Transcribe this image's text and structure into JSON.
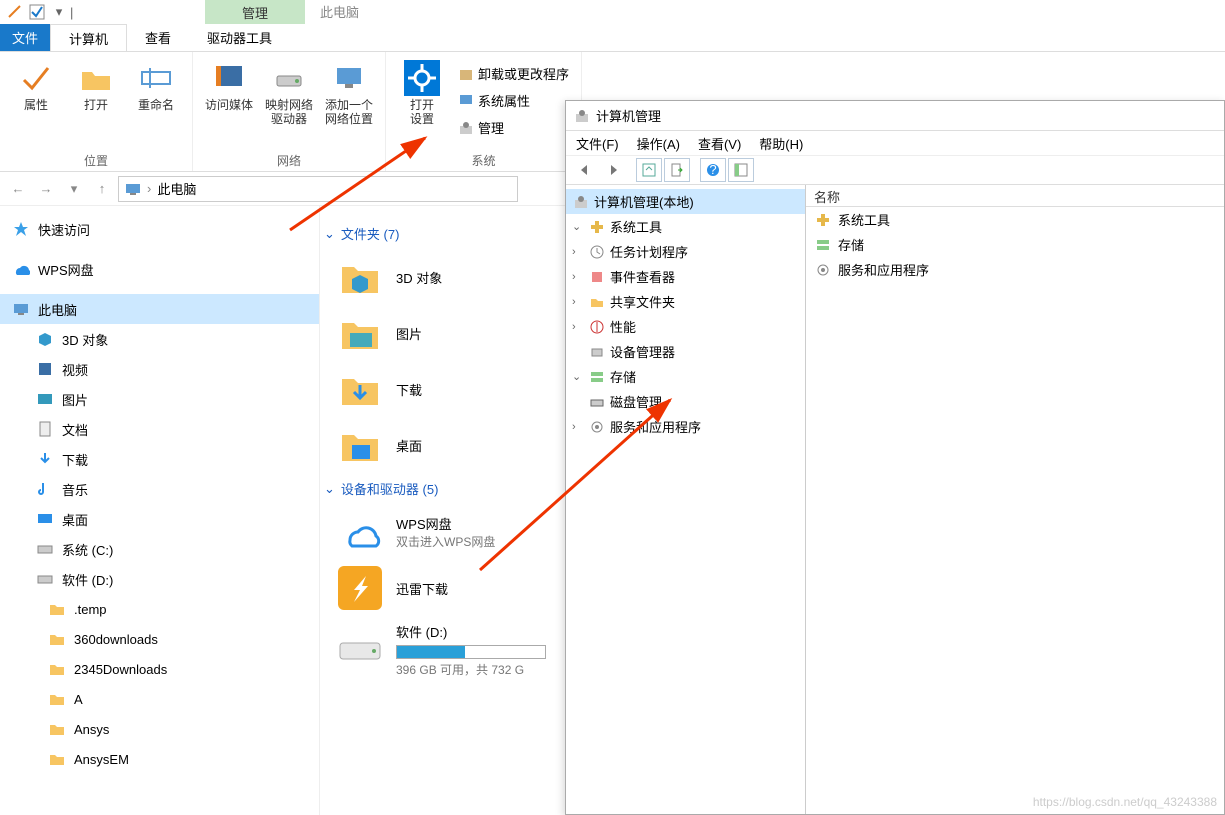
{
  "qat": {
    "context_tab": "管理",
    "context_label": "此电脑"
  },
  "tabs": {
    "file": "文件",
    "computer": "计算机",
    "view": "查看",
    "driver_tools": "驱动器工具"
  },
  "ribbon": {
    "group_location": {
      "title": "位置",
      "props": "属性",
      "open": "打开",
      "rename": "重命名"
    },
    "group_network": {
      "title": "网络",
      "access_media": "访问媒体",
      "map_drive": "映射网络\n驱动器",
      "add_netloc": "添加一个\n网络位置"
    },
    "group_system": {
      "title": "系统",
      "open_settings": "打开\n设置",
      "uninstall": "卸载或更改程序",
      "sys_props": "系统属性",
      "manage": "管理"
    }
  },
  "address": {
    "location": "此电脑"
  },
  "nav": {
    "quick": "快速访问",
    "wps": "WPS网盘",
    "thispc": "此电脑",
    "objects3d": "3D 对象",
    "videos": "视频",
    "pictures": "图片",
    "documents": "文档",
    "downloads": "下载",
    "music": "音乐",
    "desktop": "桌面",
    "system_c": "系统 (C:)",
    "soft_d": "软件 (D:)",
    "folders": {
      "temp": ".temp",
      "d360": "360downloads",
      "d2345": "2345Downloads",
      "a": "A",
      "ansys": "Ansys",
      "ansysem": "AnsysEM"
    }
  },
  "content": {
    "folders_header": "文件夹 (7)",
    "devices_header": "设备和驱动器 (5)",
    "folders": {
      "objects3d": "3D 对象",
      "pictures": "图片",
      "downloads": "下载",
      "desktop": "桌面"
    },
    "wps": {
      "title": "WPS网盘",
      "sub": "双击进入WPS网盘"
    },
    "xunlei": "迅雷下载",
    "disk_d": {
      "title": "软件 (D:)",
      "free": "396 GB 可用，共 732 G",
      "fill_pct": 46
    }
  },
  "mgmt": {
    "title": "计算机管理",
    "menu": {
      "file": "文件(F)",
      "action": "操作(A)",
      "view": "查看(V)",
      "help": "帮助(H)"
    },
    "tree": {
      "root": "计算机管理(本地)",
      "systools": "系统工具",
      "task": "任务计划程序",
      "event": "事件查看器",
      "share": "共享文件夹",
      "perf": "性能",
      "devmgr": "设备管理器",
      "storage": "存储",
      "diskmgmt": "磁盘管理",
      "services": "服务和应用程序"
    },
    "right": {
      "header": "名称",
      "systools": "系统工具",
      "storage": "存储",
      "services": "服务和应用程序"
    }
  },
  "watermark": "https://blog.csdn.net/qq_43243388"
}
